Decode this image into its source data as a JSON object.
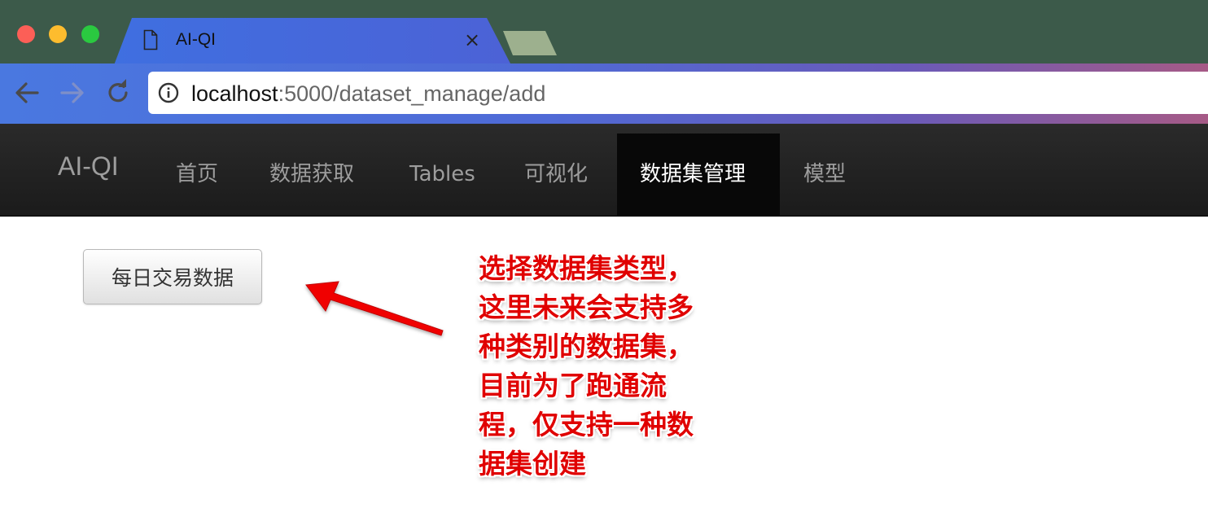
{
  "browser": {
    "tab_title": "AI-QI",
    "tab_close": "×",
    "url_host": "localhost",
    "url_rest": ":5000/dataset_manage/add",
    "colors": {
      "chrome": "#3c5a4a",
      "tab_accent": "#4c62d6"
    }
  },
  "navbar": {
    "brand": "AI-QI",
    "items": [
      {
        "label": "首页"
      },
      {
        "label": "数据获取"
      },
      {
        "label": "Tables"
      },
      {
        "label": "可视化"
      },
      {
        "label": "数据集管理",
        "active": true
      },
      {
        "label": "模型"
      }
    ]
  },
  "content": {
    "dataset_type_button": "每日交易数据"
  },
  "annotation": {
    "note": "选择数据集类型，\n这里未来会支持多\n种类别的数据集，\n目前为了跑通流\n程，仅支持一种数\n据集创建",
    "color": "#e00000"
  }
}
